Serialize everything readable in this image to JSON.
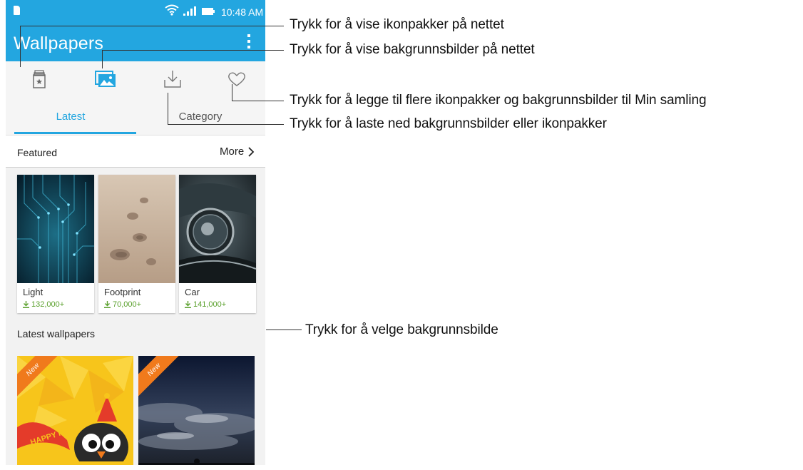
{
  "status_bar": {
    "time": "10:48 AM"
  },
  "app_bar": {
    "title": "Wallpapers"
  },
  "toolbar": {
    "icons": [
      "icon-pack-icon",
      "wallpaper-icon",
      "download-icon",
      "heart-icon"
    ],
    "accent_color": "#23a6e0"
  },
  "tabs": [
    {
      "label": "Latest",
      "selected": true
    },
    {
      "label": "Category",
      "selected": false
    }
  ],
  "featured": {
    "title": "Featured",
    "more_label": "More",
    "items": [
      {
        "name": "Light",
        "downloads": "132,000+"
      },
      {
        "name": "Footprint",
        "downloads": "70,000+"
      },
      {
        "name": "Car",
        "downloads": "141,000+"
      }
    ]
  },
  "latest": {
    "title": "Latest wallpapers",
    "items": [
      {
        "badge": "New",
        "art_text": "HAPPY NEW YEAR"
      },
      {
        "badge": "New"
      }
    ]
  },
  "callouts": [
    "Trykk for å vise ikonpakker på nettet",
    "Trykk for å vise bakgrunnsbilder på nettet",
    "Trykk for å legge til flere ikonpakker og bakgrunnsbilder til Min samling",
    "Trykk for å laste ned bakgrunnsbilder eller ikonpakker",
    "Trykk for å velge bakgrunnsbilde"
  ],
  "colors": {
    "accent": "#23a6e0",
    "download_count": "#5aa02c",
    "new_badge": "#f07a1c"
  }
}
